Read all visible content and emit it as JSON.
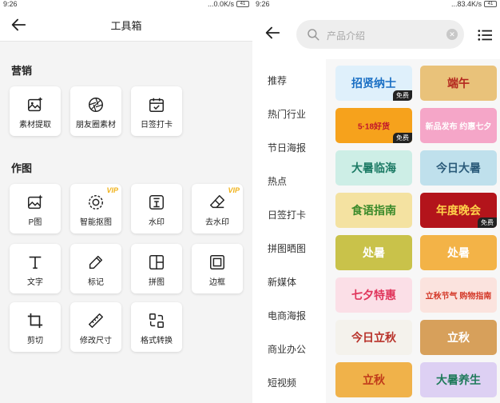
{
  "left": {
    "status": {
      "time": "9:26",
      "speed": "...0.0K/s",
      "battery": "41"
    },
    "header": {
      "title": "工具箱"
    },
    "sections": [
      {
        "title": "营销",
        "items": [
          {
            "label": "素材提取",
            "icon": "image-plus-icon",
            "vip": ""
          },
          {
            "label": "朋友圈素材",
            "icon": "aperture-icon",
            "vip": ""
          },
          {
            "label": "日签打卡",
            "icon": "calendar-check-icon",
            "vip": ""
          }
        ]
      },
      {
        "title": "作图",
        "items": [
          {
            "label": "P图",
            "icon": "image-sparkle-icon",
            "vip": ""
          },
          {
            "label": "智能抠图",
            "icon": "cutout-icon",
            "vip": "VIP"
          },
          {
            "label": "水印",
            "icon": "watermark-icon",
            "vip": ""
          },
          {
            "label": "去水印",
            "icon": "eraser-icon",
            "vip": "VIP"
          },
          {
            "label": "文字",
            "icon": "text-icon",
            "vip": ""
          },
          {
            "label": "标记",
            "icon": "pen-icon",
            "vip": ""
          },
          {
            "label": "拼图",
            "icon": "layout-icon",
            "vip": ""
          },
          {
            "label": "边框",
            "icon": "frame-icon",
            "vip": ""
          },
          {
            "label": "剪切",
            "icon": "crop-icon",
            "vip": ""
          },
          {
            "label": "修改尺寸",
            "icon": "ruler-icon",
            "vip": ""
          },
          {
            "label": "格式转换",
            "icon": "convert-icon",
            "vip": ""
          }
        ]
      }
    ]
  },
  "right": {
    "status": {
      "time": "9:26",
      "speed": "...83.4K/s",
      "battery": "41"
    },
    "search": {
      "placeholder": "产品介绍"
    },
    "categories": [
      "推荐",
      "热门行业",
      "节日海报",
      "热点",
      "日签打卡",
      "拼图晒图",
      "新媒体",
      "电商海报",
      "商业办公",
      "短视频"
    ],
    "cards": [
      {
        "text": "招贤纳士",
        "free": "免费",
        "bg": "#dff0fb",
        "fg": "#1a6fc4"
      },
      {
        "text": "端午",
        "free": "",
        "bg": "#e9c27a",
        "fg": "#b3261e"
      },
      {
        "text": "5·18好货",
        "free": "免费",
        "bg": "#f6a21c",
        "fg": "#c0132b"
      },
      {
        "text": "新品发布 约惠七夕",
        "free": "",
        "bg": "#f5a6c8",
        "fg": "#ffffff"
      },
      {
        "text": "大暑临海",
        "free": "",
        "bg": "#cdeee6",
        "fg": "#1b7a64"
      },
      {
        "text": "今日大暑",
        "free": "",
        "bg": "#bfe0ec",
        "fg": "#2b5b7a"
      },
      {
        "text": "食语指南",
        "free": "",
        "bg": "#f4e2a1",
        "fg": "#3a8a2a"
      },
      {
        "text": "年度晚会",
        "free": "免费",
        "bg": "#b3141b",
        "fg": "#ffd24a"
      },
      {
        "text": "处暑",
        "free": "",
        "bg": "#c9c24a",
        "fg": "#ffffff"
      },
      {
        "text": "处暑",
        "free": "",
        "bg": "#f3b347",
        "fg": "#ffffff"
      },
      {
        "text": "七夕特惠",
        "free": "",
        "bg": "#fbdfe7",
        "fg": "#e0345b"
      },
      {
        "text": "立秋节气 购物指南",
        "free": "",
        "bg": "#fbe3de",
        "fg": "#d43a2a"
      },
      {
        "text": "今日立秋",
        "free": "",
        "bg": "#f4f2ec",
        "fg": "#b8322a"
      },
      {
        "text": "立秋",
        "free": "",
        "bg": "#d7a05b",
        "fg": "#ffffff"
      },
      {
        "text": "立秋",
        "free": "",
        "bg": "#f0b24a",
        "fg": "#c03a1a"
      },
      {
        "text": "大暑养生",
        "free": "",
        "bg": "#ddd0f3",
        "fg": "#1e7a5a"
      }
    ]
  }
}
